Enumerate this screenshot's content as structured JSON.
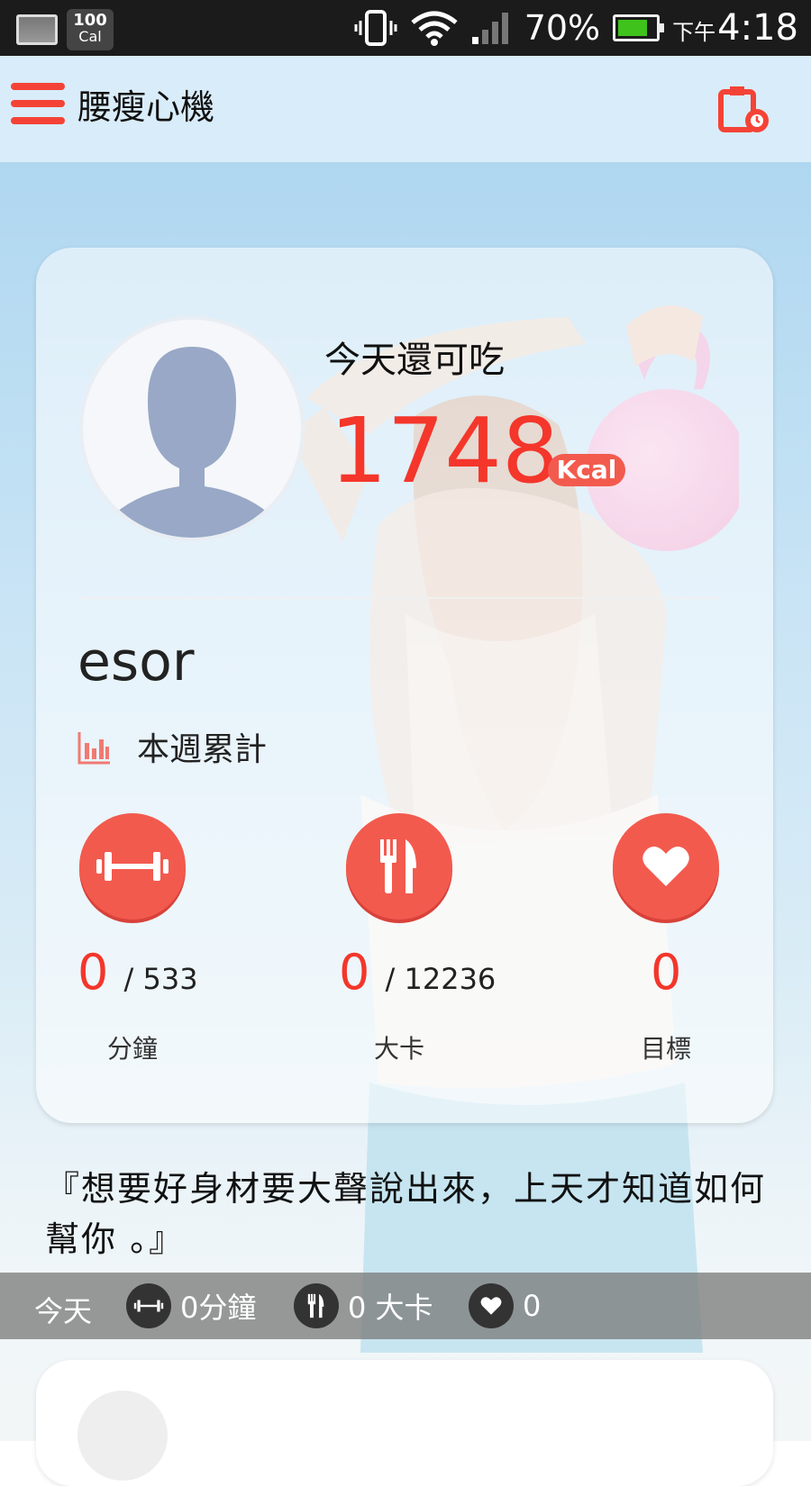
{
  "status_bar": {
    "cal_number": "100",
    "cal_label": "Cal",
    "battery_percent": "70%",
    "time_prefix": "下午",
    "time": "4:18"
  },
  "app_bar": {
    "title": "腰瘦心機"
  },
  "summary": {
    "remain_label": "今天還可吃",
    "remain_value": "1748",
    "unit_badge": "Kcal",
    "username": "esor",
    "weekly_label": "本週累計"
  },
  "stats": [
    {
      "icon": "dumbbell-icon",
      "value": "0",
      "total": "/ 533",
      "unit": "分鐘"
    },
    {
      "icon": "fork-knife-icon",
      "value": "0",
      "total": "/ 12236",
      "unit": "大卡"
    },
    {
      "icon": "heart-icon",
      "value": "0",
      "total": "",
      "unit": "目標"
    }
  ],
  "quote": "『想要好身材要大聲說出來，上天才知道如何幫你 。』",
  "today_bar": {
    "label": "今天",
    "exercise": "0分鐘",
    "calories": "0 大卡",
    "goal": "0"
  },
  "colors": {
    "accent": "#f35a4e",
    "value_red": "#f4362b"
  }
}
